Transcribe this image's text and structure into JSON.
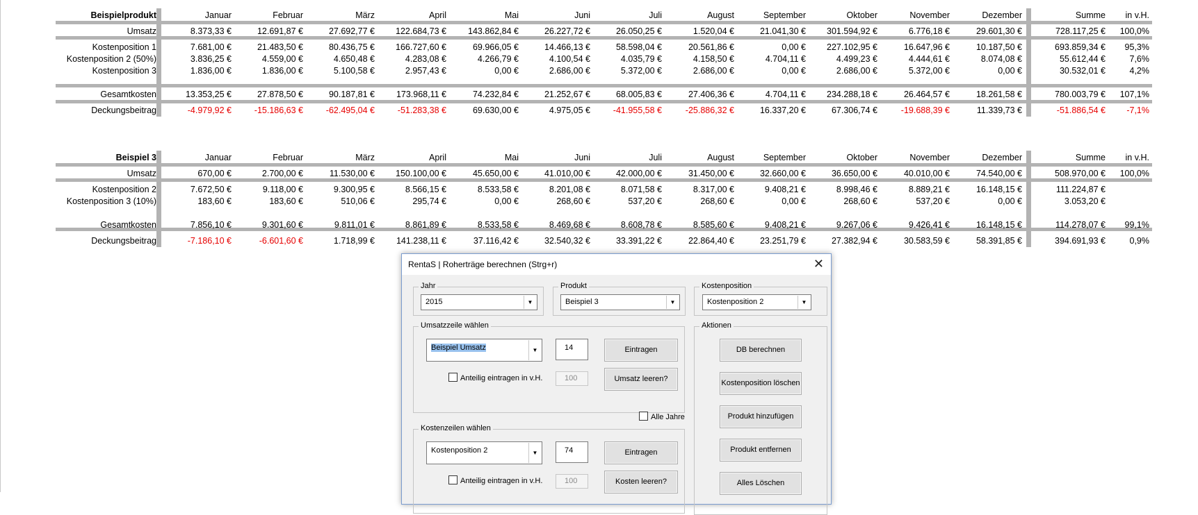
{
  "months": [
    "Januar",
    "Februar",
    "März",
    "April",
    "Mai",
    "Juni",
    "Juli",
    "August",
    "September",
    "Oktober",
    "November",
    "Dezember"
  ],
  "col_sum": "Summe",
  "col_pct": "in v.H.",
  "table1": {
    "title": "Beispielprodukt",
    "rows": [
      {
        "label": "Umsatz",
        "values": [
          "8.373,33 €",
          "12.691,87 €",
          "27.692,77 €",
          "122.684,73 €",
          "143.862,84 €",
          "26.227,72 €",
          "26.050,25 €",
          "1.520,04 €",
          "21.041,30 €",
          "301.594,92 €",
          "6.776,18 €",
          "29.601,30 €"
        ],
        "sum": "728.117,25 €",
        "pct": "100,0%"
      },
      {
        "label": "Kostenposition 1",
        "values": [
          "7.681,00 €",
          "21.483,50 €",
          "80.436,75 €",
          "166.727,60 €",
          "69.966,05 €",
          "14.466,13 €",
          "58.598,04 €",
          "20.561,86 €",
          "0,00 €",
          "227.102,95 €",
          "16.647,96 €",
          "10.187,50 €"
        ],
        "sum": "693.859,34 €",
        "pct": "95,3%"
      },
      {
        "label": "Kostenposition 2 (50%)",
        "values": [
          "3.836,25 €",
          "4.559,00 €",
          "4.650,48 €",
          "4.283,08 €",
          "4.266,79 €",
          "4.100,54 €",
          "4.035,79 €",
          "4.158,50 €",
          "4.704,11 €",
          "4.499,23 €",
          "4.444,61 €",
          "8.074,08 €"
        ],
        "sum": "55.612,44 €",
        "pct": "7,6%"
      },
      {
        "label": "Kostenposition 3",
        "values": [
          "1.836,00 €",
          "1.836,00 €",
          "5.100,58 €",
          "2.957,43 €",
          "0,00 €",
          "2.686,00 €",
          "5.372,00 €",
          "2.686,00 €",
          "0,00 €",
          "2.686,00 €",
          "5.372,00 €",
          "0,00 €"
        ],
        "sum": "30.532,01 €",
        "pct": "4,2%"
      },
      {
        "label": "Gesamtkosten",
        "values": [
          "13.353,25 €",
          "27.878,50 €",
          "90.187,81 €",
          "173.968,11 €",
          "74.232,84 €",
          "21.252,67 €",
          "68.005,83 €",
          "27.406,36 €",
          "4.704,11 €",
          "234.288,18 €",
          "26.464,57 €",
          "18.261,58 €"
        ],
        "sum": "780.003,79 €",
        "pct": "107,1%"
      },
      {
        "label": "Deckungsbeitrag",
        "values": [
          "-4.979,92 €",
          "-15.186,63 €",
          "-62.495,04 €",
          "-51.283,38 €",
          "69.630,00 €",
          "4.975,05 €",
          "-41.955,58 €",
          "-25.886,32 €",
          "16.337,20 €",
          "67.306,74 €",
          "-19.688,39 €",
          "11.339,73 €"
        ],
        "sum": "-51.886,54 €",
        "pct": "-7,1%"
      }
    ]
  },
  "table2": {
    "title": "Beispiel 3",
    "rows": [
      {
        "label": "Umsatz",
        "values": [
          "670,00 €",
          "2.700,00 €",
          "11.530,00 €",
          "150.100,00 €",
          "45.650,00 €",
          "41.010,00 €",
          "42.000,00 €",
          "31.450,00 €",
          "32.660,00 €",
          "36.650,00 €",
          "40.010,00 €",
          "74.540,00 €"
        ],
        "sum": "508.970,00 €",
        "pct": "100,0%"
      },
      {
        "label": "Kostenposition 2",
        "values": [
          "7.672,50 €",
          "9.118,00 €",
          "9.300,95 €",
          "8.566,15 €",
          "8.533,58 €",
          "8.201,08 €",
          "8.071,58 €",
          "8.317,00 €",
          "9.408,21 €",
          "8.998,46 €",
          "8.889,21 €",
          "16.148,15 €"
        ],
        "sum": "111.224,87 €",
        "pct": ""
      },
      {
        "label": "Kostenposition 3 (10%)",
        "values": [
          "183,60 €",
          "183,60 €",
          "510,06 €",
          "295,74 €",
          "0,00 €",
          "268,60 €",
          "537,20 €",
          "268,60 €",
          "0,00 €",
          "268,60 €",
          "537,20 €",
          "0,00 €"
        ],
        "sum": "3.053,20 €",
        "pct": ""
      },
      {
        "label": "Gesamtkosten",
        "values": [
          "7.856,10 €",
          "9.301,60 €",
          "9.811,01 €",
          "8.861,89 €",
          "8.533,58 €",
          "8.469,68 €",
          "8.608,78 €",
          "8.585,60 €",
          "9.408,21 €",
          "9.267,06 €",
          "9.426,41 €",
          "16.148,15 €"
        ],
        "sum": "114.278,07 €",
        "pct": "99,1%"
      },
      {
        "label": "Deckungsbeitrag",
        "values": [
          "-7.186,10 €",
          "-6.601,60 €",
          "1.718,99 €",
          "141.238,11 €",
          "37.116,42 €",
          "32.540,32 €",
          "33.391,22 €",
          "22.864,40 €",
          "23.251,79 €",
          "27.382,94 €",
          "30.583,59 €",
          "58.391,85 €"
        ],
        "sum": "394.691,93 €",
        "pct": "0,9%"
      }
    ]
  },
  "dialog": {
    "title": "RentaS | Roherträge berechnen (Strg+r)",
    "close": "✕",
    "jahr": {
      "legend": "Jahr",
      "value": "2015"
    },
    "produkt": {
      "legend": "Produkt",
      "value": "Beispiel 3"
    },
    "kostenposition": {
      "legend": "Kostenposition",
      "value": "Kostenposition 2"
    },
    "umsatz": {
      "legend": "Umsatzzeile wählen",
      "combo": "Beispiel Umsatz",
      "row": "14",
      "eintragen": "Eintragen",
      "anteilig": "Anteilig eintragen in v.H.",
      "pct": "100",
      "leeren": "Umsatz leeren?"
    },
    "alle_jahre": "Alle Jahre",
    "kosten": {
      "legend": "Kostenzeilen wählen",
      "combo": "Kostenposition 2",
      "row": "74",
      "eintragen": "Eintragen",
      "anteilig": "Anteilig eintragen in v.H.",
      "pct": "100",
      "leeren": "Kosten leeren?"
    },
    "aktionen": {
      "legend": "Aktionen",
      "buttons": [
        "DB berechnen",
        "Kostenposition löschen",
        "Produkt hinzufügen",
        "Produkt entfernen",
        "Alles Löschen"
      ]
    }
  },
  "colors": {
    "negative": "#e60000",
    "band": "#b3b3b3"
  }
}
